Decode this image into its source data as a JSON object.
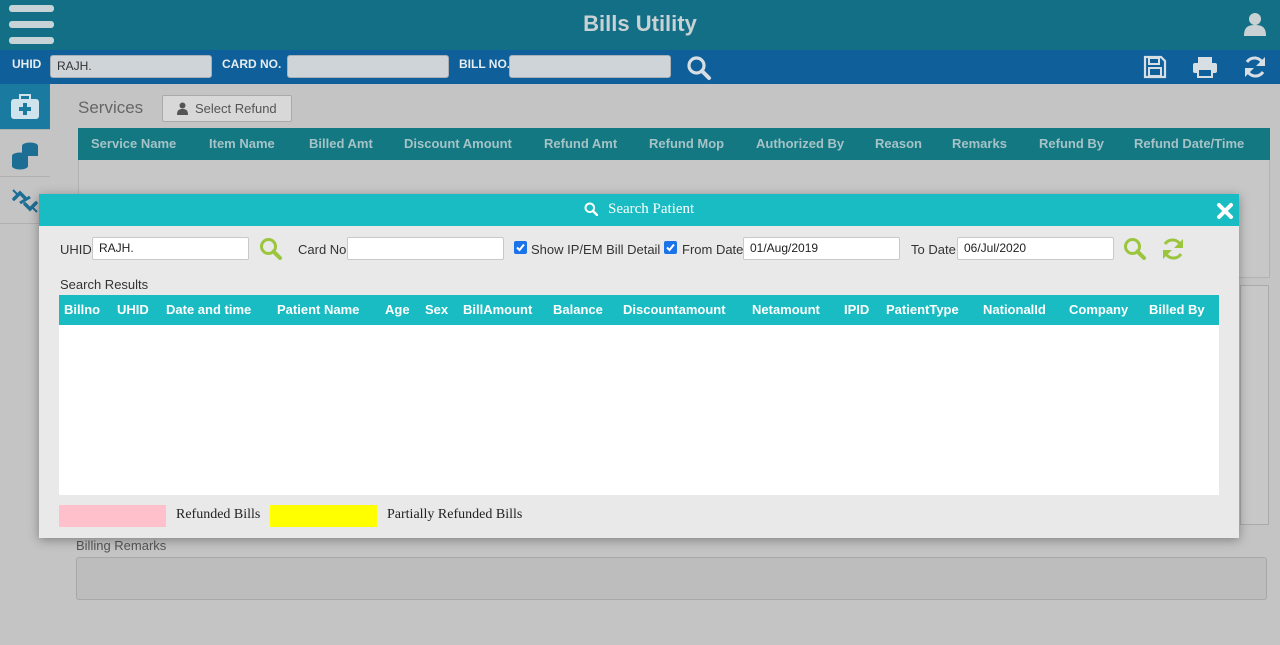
{
  "app": {
    "title": "Bills Utility"
  },
  "search_bar": {
    "uhid_label": "UHID",
    "uhid_value": "RAJH.",
    "card_label": "CARD NO.",
    "card_value": "",
    "bill_label": "BILL NO.",
    "bill_value": ""
  },
  "left_rail": [
    "medical-kit-icon",
    "coins-icon",
    "broken-link-icon"
  ],
  "services": {
    "title": "Services",
    "select_refund_label": "Select Refund",
    "columns": [
      "Service Name",
      "Item Name",
      "Billed Amt",
      "Discount Amount",
      "Refund Amt",
      "Refund Mop",
      "Authorized By",
      "Reason",
      "Remarks",
      "Refund By",
      "Refund Date/Time"
    ],
    "rows": []
  },
  "billing_remarks": {
    "label": "Billing Remarks",
    "value": ""
  },
  "modal": {
    "title": "Search Patient",
    "uhid_label": "UHID",
    "uhid_value": "RAJH.",
    "card_label": "Card No",
    "card_value": "",
    "show_ip_label": "Show IP/EM Bill Detail",
    "show_ip_checked": true,
    "from_date_label": "From Date",
    "from_date_checked": true,
    "from_date_value": "01/Aug/2019",
    "to_date_label": "To Date",
    "to_date_value": "06/Jul/2020",
    "results_label": "Search Results",
    "columns": [
      "Billno",
      "UHID",
      "Date and time",
      "Patient Name",
      "Age",
      "Sex",
      "BillAmount",
      "Balance",
      "Discountamount",
      "Netamount",
      "IPID",
      "PatientType",
      "NationalId",
      "Company",
      "Billed By"
    ],
    "rows": [],
    "legend": [
      {
        "label": "Refunded Bills",
        "color": "#ffc0cb"
      },
      {
        "label": "Partially Refunded Bills",
        "color": "#ffff00"
      }
    ]
  },
  "colors": {
    "title_bar": "#126f85",
    "search_bar": "#0e5f9a",
    "modal_accent": "#19bcc2",
    "icon_green": "#9bc53d"
  }
}
